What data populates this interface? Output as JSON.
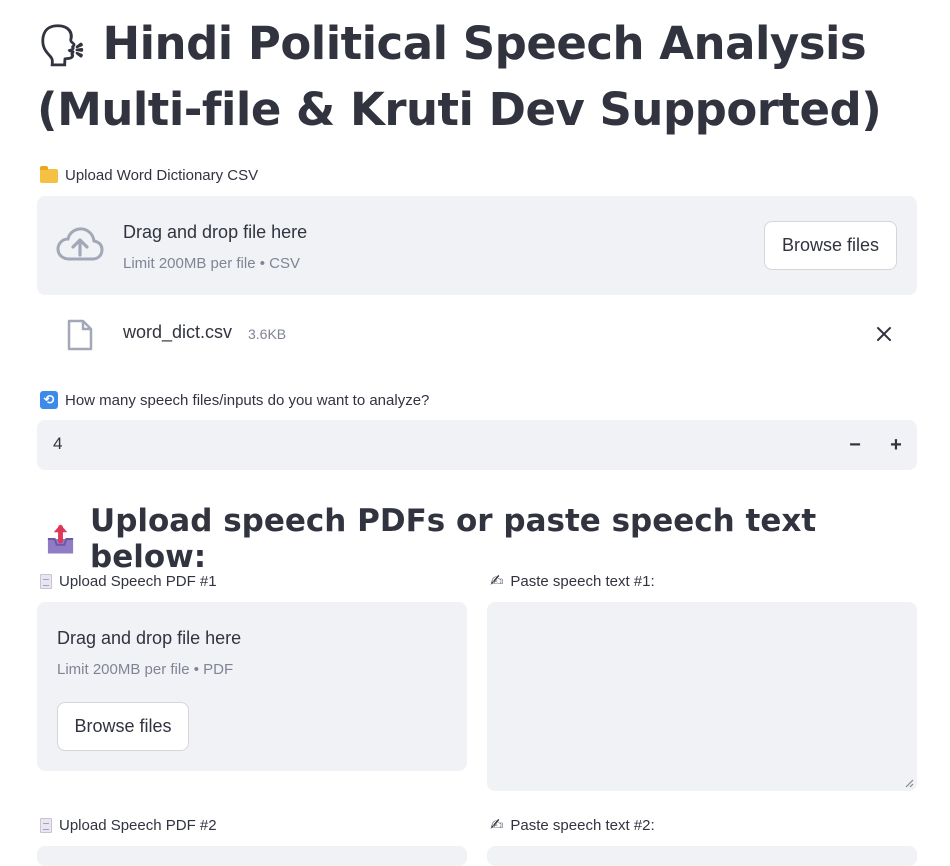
{
  "title": {
    "emoji": "🗣",
    "text": "Hindi Political Speech Analysis (Multi-file & Kruti Dev Supported)"
  },
  "dictionary_uploader": {
    "label": "Upload Word Dictionary CSV",
    "label_icon": "folder-icon",
    "drag_text": "Drag and drop file here",
    "limit_text": "Limit 200MB per file • CSV",
    "browse_label": "Browse files",
    "uploaded_file": {
      "name": "word_dict.csv",
      "size": "3.6KB"
    }
  },
  "count_input": {
    "label": "How many speech files/inputs do you want to analyze?",
    "label_icon": "repeat-icon",
    "value": "4",
    "minus_label": "−",
    "plus_label": "+"
  },
  "section": {
    "icon": "outbox-tray-icon",
    "heading": "Upload speech PDFs or paste speech text below:"
  },
  "speech_inputs": [
    {
      "pdf_label": "Upload Speech PDF #1",
      "drag_text": "Drag and drop file here",
      "limit_text": "Limit 200MB per file • PDF",
      "browse_label": "Browse files",
      "text_label": "Paste speech text #1:",
      "text_value": ""
    },
    {
      "pdf_label": "Upload Speech PDF #2",
      "text_label": "Paste speech text #2:"
    }
  ],
  "colors": {
    "background": "#ffffff",
    "widget_background": "#f0f2f6",
    "text": "#31333f",
    "muted_text": "#808495"
  }
}
